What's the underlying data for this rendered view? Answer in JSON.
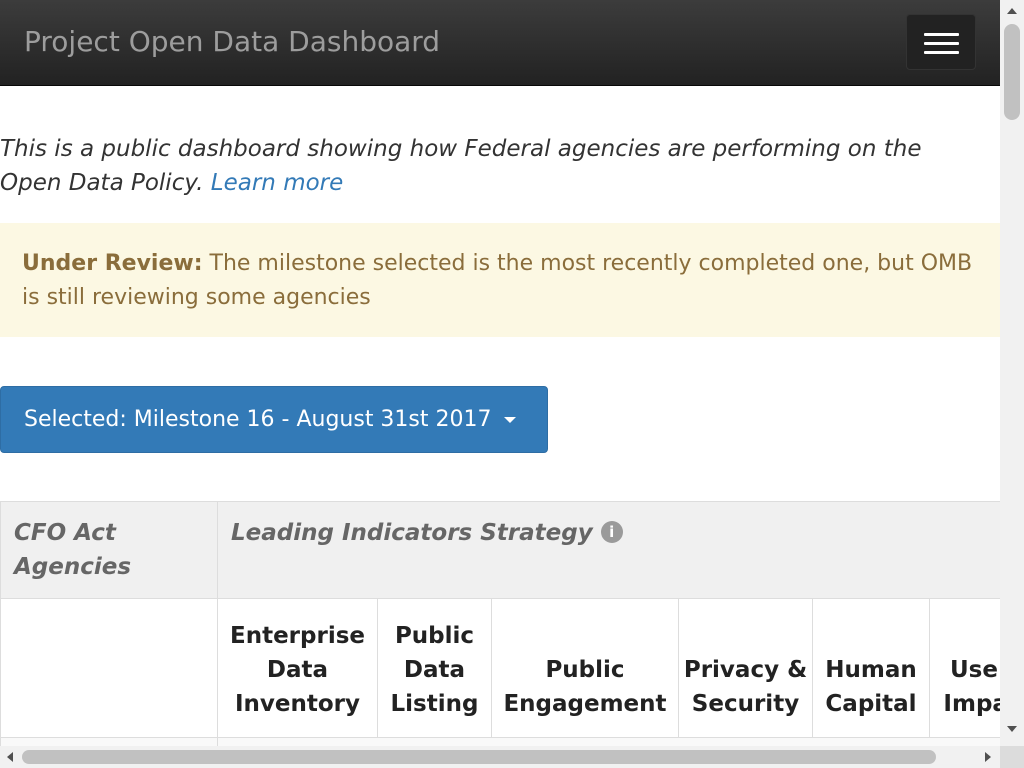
{
  "navbar": {
    "brand": "Project Open Data Dashboard",
    "menu_icon": "hamburger-menu-icon"
  },
  "intro": {
    "text": "This is a public dashboard showing how Federal agencies are performing on the Open Data Policy.",
    "link": "Learn more"
  },
  "alert": {
    "title": "Under Review:",
    "text": "The milestone selected is the most recently completed one, but OMB is still reviewing some agencies"
  },
  "milestone": {
    "label": "Selected: Milestone 16 - August 31st 2017"
  },
  "table": {
    "group_header": "CFO Act Agencies",
    "section_header": "Leading Indicators Strategy",
    "info_icon": "info-circle-icon",
    "columns": [
      "Enterprise Data Inventory",
      "Public Data Listing",
      "Public Engagement",
      "Privacy & Security",
      "Human Capital",
      "Use & Impact"
    ]
  },
  "colors": {
    "navbar": "#222222",
    "link": "#337ab7",
    "alert_bg": "#fcf8e3",
    "alert_text": "#8a6d3b",
    "button": "#337ab7"
  }
}
